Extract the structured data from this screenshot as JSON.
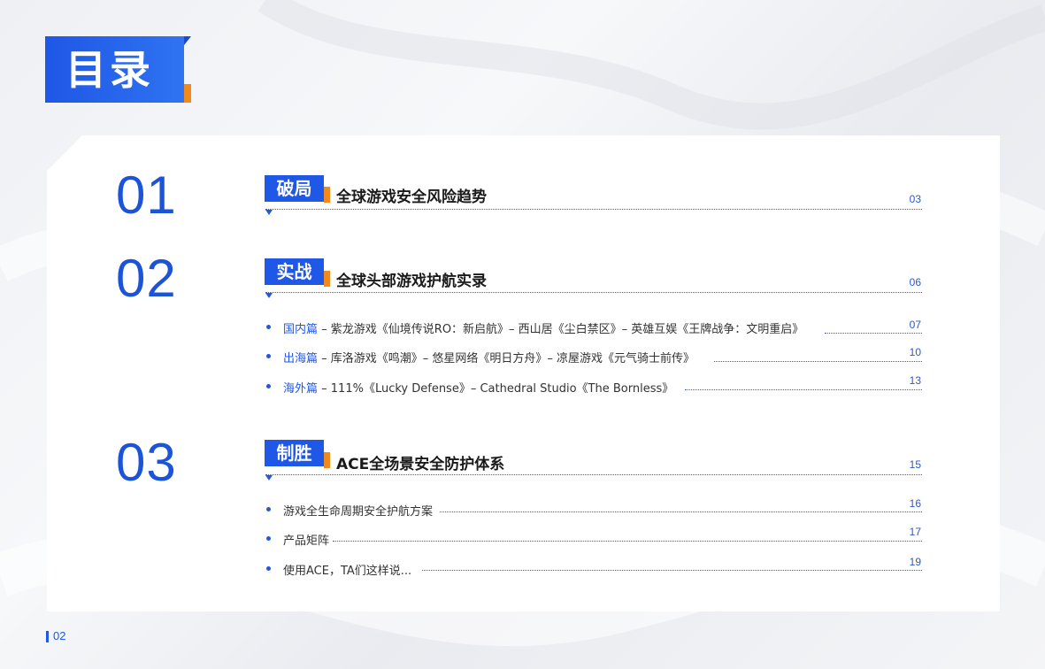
{
  "title": "目录",
  "sections": [
    {
      "number": "01",
      "tag": "破局",
      "heading": "全球游戏安全风险趋势",
      "page": "03",
      "items": []
    },
    {
      "number": "02",
      "tag": "实战",
      "heading": "全球头部游戏护航实录",
      "page": "06",
      "items": [
        {
          "highlight": "国内篇",
          "text": " – 紫龙游戏《仙境传说RO：新启航》– 西山居《尘白禁区》– 英雄互娱《王牌战争：文明重启》",
          "page": "07"
        },
        {
          "highlight": "出海篇",
          "text": " – 库洛游戏《鸣潮》– 悠星网络《明日方舟》– 凉屋游戏《元气骑士前传》",
          "page": "10"
        },
        {
          "highlight": "海外篇",
          "text": " – 111%《Lucky Defense》– Cathedral Studio《The Bornless》",
          "page": "13"
        }
      ]
    },
    {
      "number": "03",
      "tag": "制胜",
      "heading": "ACE全场景安全防护体系",
      "page": "15",
      "items": [
        {
          "highlight": "",
          "text": "游戏全生命周期安全护航方案",
          "page": "16"
        },
        {
          "highlight": "",
          "text": "产品矩阵",
          "page": "17"
        },
        {
          "highlight": "",
          "text": "使用ACE，TA们这样说...",
          "page": "19"
        }
      ]
    }
  ],
  "footer": {
    "page_number": "02"
  },
  "colors": {
    "primary": "#1f57e6",
    "accent": "#f08a1c"
  }
}
